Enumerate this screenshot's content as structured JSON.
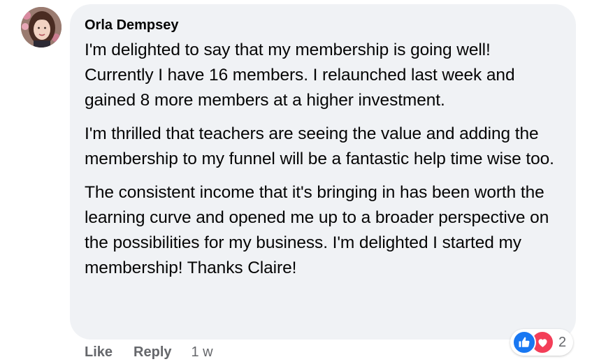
{
  "comment": {
    "author": "Orla Dempsey",
    "paragraphs": [
      "I'm delighted to say that my membership is going well! Currently I have 16 members. I relaunched last week and gained 8 more members at a higher investment.",
      "I'm thrilled that teachers are seeing the value and adding the membership to my funnel will be a fantastic help time wise too.",
      "The consistent income that it's bringing in has been worth the learning curve and opened me up to a broader perspective on the possibilities for my business. I'm delighted I started my membership! Thanks Claire!"
    ],
    "reactions": {
      "icons": [
        "like-icon",
        "love-icon"
      ],
      "count": "2"
    },
    "actions": {
      "like_label": "Like",
      "reply_label": "Reply",
      "timestamp": "1 w"
    }
  },
  "colors": {
    "bubble_bg": "#f0f2f5",
    "like_blue": "#1877f2",
    "love_red": "#f33e58",
    "secondary_text": "#65676b"
  }
}
